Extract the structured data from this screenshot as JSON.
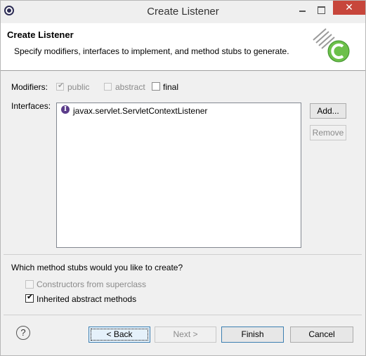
{
  "window": {
    "title": "Create Listener",
    "minimize": "–",
    "maximize": "☐",
    "close": "✕"
  },
  "header": {
    "title": "Create Listener",
    "description": "Specify modifiers, interfaces to implement, and method stubs to generate."
  },
  "modifiers": {
    "label": "Modifiers:",
    "public": {
      "label": "public",
      "checked": true,
      "enabled": false
    },
    "abstract": {
      "label": "abstract",
      "checked": false,
      "enabled": false
    },
    "final": {
      "label": "final",
      "checked": false,
      "enabled": true
    }
  },
  "interfaces": {
    "label": "Interfaces:",
    "items": [
      "javax.servlet.ServletContextListener"
    ],
    "add_label": "Add...",
    "remove_label": "Remove"
  },
  "stubs": {
    "question": "Which method stubs would you like to create?",
    "constructors": {
      "label": "Constructors from superclass",
      "checked": false,
      "enabled": false
    },
    "inherited": {
      "label": "Inherited abstract methods",
      "checked": true,
      "enabled": true
    }
  },
  "footer": {
    "back_label": "< Back",
    "next_label": "Next >",
    "finish_label": "Finish",
    "cancel_label": "Cancel",
    "help": "?"
  },
  "icons": {
    "app": "eclipse-icon",
    "interface": "interface-icon",
    "banner": "new-class-wizard-icon",
    "help": "help-icon"
  },
  "colors": {
    "close_button": "#c7463b",
    "banner_green": "#6cc04a",
    "interface_icon": "#5b3c8a"
  }
}
